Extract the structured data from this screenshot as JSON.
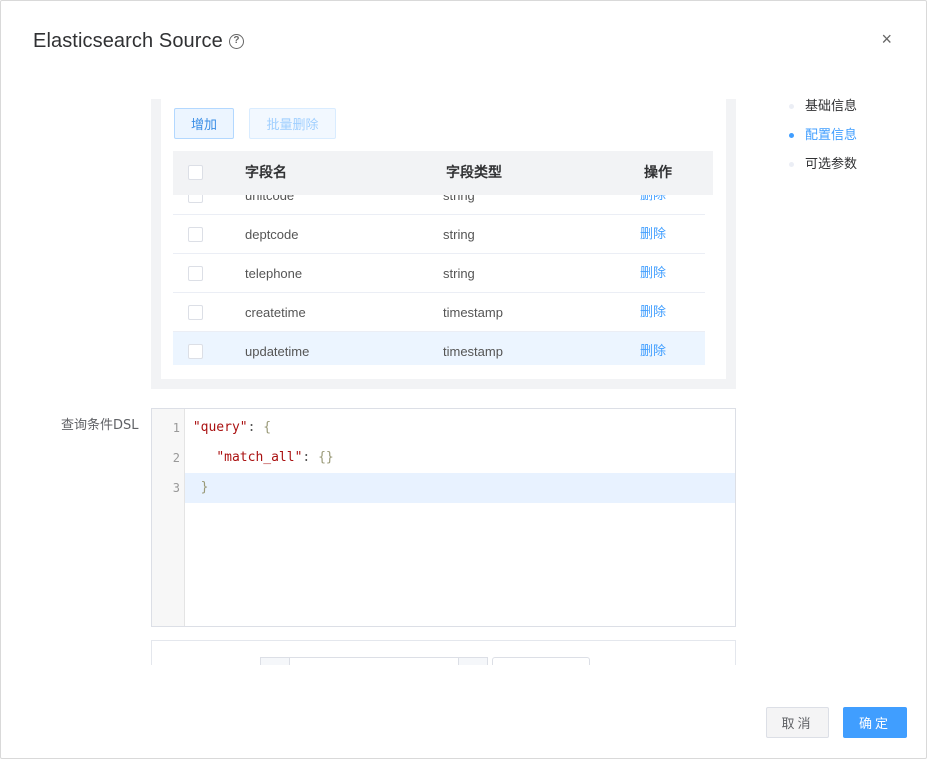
{
  "dialog": {
    "title": "Elasticsearch Source",
    "help_icon_glyph": "?",
    "close_glyph": "×"
  },
  "toolbar": {
    "add_label": "增加",
    "batch_delete_label": "批量删除"
  },
  "table": {
    "headers": [
      "字段名",
      "字段类型",
      "操作"
    ],
    "rows": [
      {
        "name": "unitcode",
        "type": "string",
        "action": "删除",
        "highlighted": false
      },
      {
        "name": "deptcode",
        "type": "string",
        "action": "删除",
        "highlighted": false
      },
      {
        "name": "telephone",
        "type": "string",
        "action": "删除",
        "highlighted": false
      },
      {
        "name": "createtime",
        "type": "timestamp",
        "action": "删除",
        "highlighted": false
      },
      {
        "name": "updatetime",
        "type": "timestamp",
        "action": "删除",
        "highlighted": true
      }
    ]
  },
  "dsl": {
    "label": "查询条件DSL",
    "line_numbers": [
      "1",
      "2",
      "3"
    ],
    "lines": [
      {
        "indent": " ",
        "key": "\"query\"",
        "sep": ": ",
        "brace": "{"
      },
      {
        "indent": "    ",
        "key": "\"match_all\"",
        "sep": ": ",
        "brace": "{}"
      },
      {
        "indent": "  ",
        "key": "",
        "sep": "",
        "brace": "}"
      }
    ],
    "active_line": 3
  },
  "anchor_nav": [
    {
      "label": "基础信息",
      "active": false
    },
    {
      "label": "配置信息",
      "active": true
    },
    {
      "label": "可选参数",
      "active": false
    }
  ],
  "footer": {
    "cancel_label": "取消",
    "ok_label": "确定"
  },
  "colors": {
    "primary": "#409eff",
    "row_highlight": "#ecf5ff"
  }
}
